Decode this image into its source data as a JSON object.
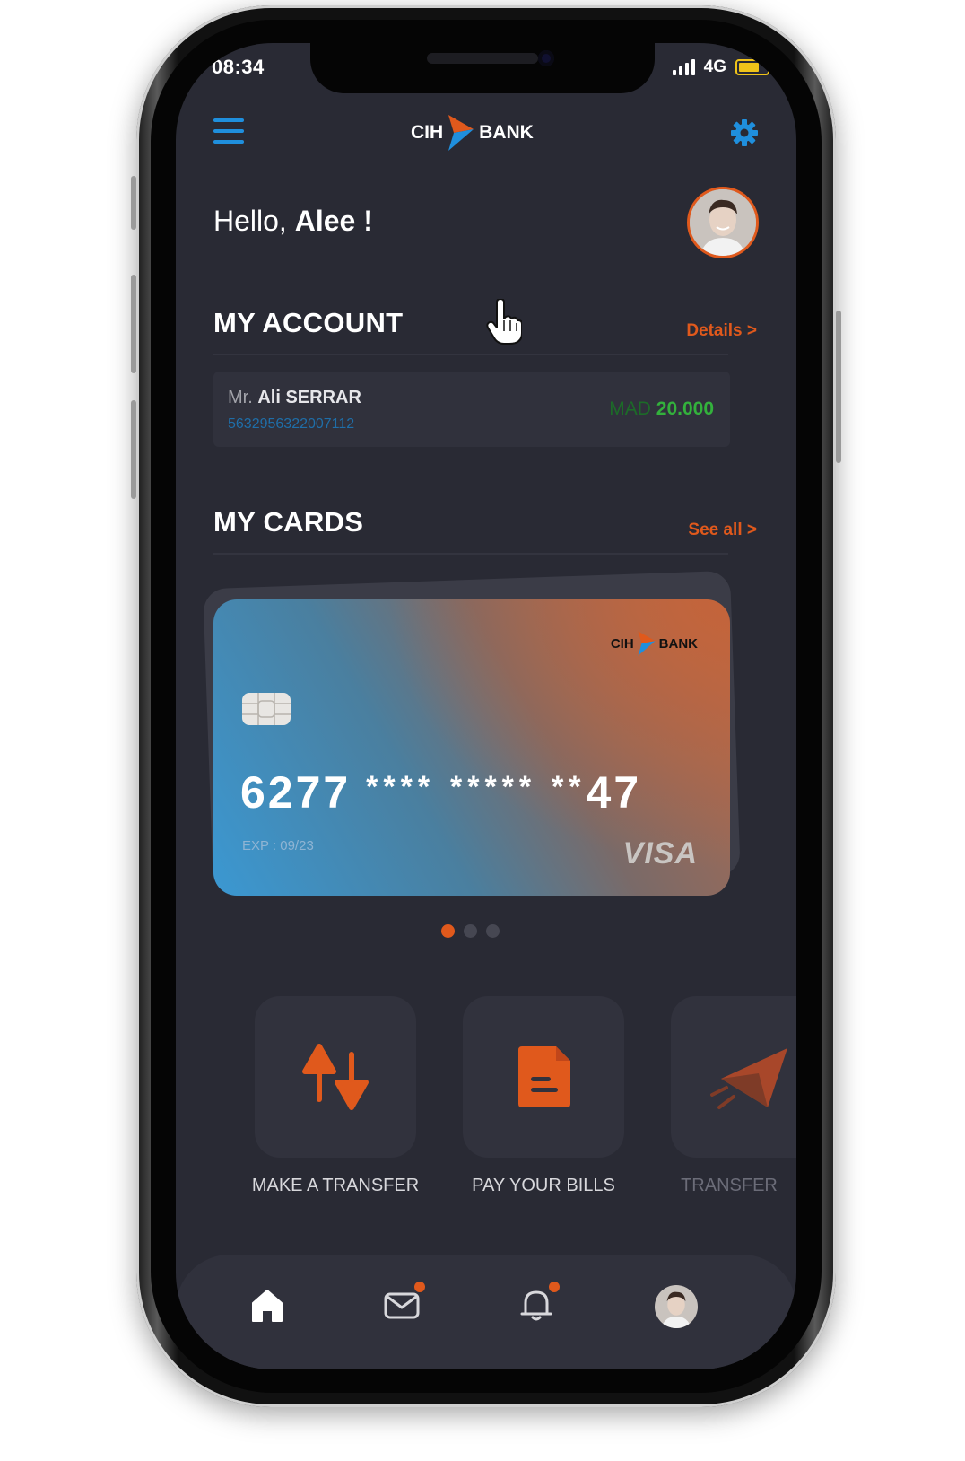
{
  "status_bar": {
    "time": "08:34",
    "network": "4G"
  },
  "header": {
    "logo_left": "CIH",
    "logo_right": "BANK"
  },
  "greeting": {
    "prefix": "Hello, ",
    "name": "Alee !"
  },
  "account_section": {
    "title": "MY ACCOUNT",
    "link": "Details >",
    "holder_prefix": "Mr.",
    "holder_name": "Ali SERRAR",
    "account_number": "5632956322007112",
    "currency": "MAD",
    "balance": "20.000"
  },
  "cards_section": {
    "title": "MY CARDS",
    "link": "See all >",
    "card": {
      "logo_left": "CIH",
      "logo_right": "BANK",
      "number_first": "6277",
      "number_masked_1": "****",
      "number_masked_2": "*****",
      "number_masked_3": "**",
      "number_last": "47",
      "expiry": "EXP : 09/23",
      "network": "VISA"
    },
    "pager": {
      "count": 3,
      "active_index": 0
    }
  },
  "actions": [
    {
      "label": "MAKE A TRANSFER",
      "icon": "transfer-arrows-icon"
    },
    {
      "label": "PAY YOUR BILLS",
      "icon": "bill-document-icon"
    },
    {
      "label": "TRANSFER",
      "icon": "paper-plane-icon"
    }
  ],
  "bottom_nav": [
    {
      "name": "home",
      "icon": "home-icon"
    },
    {
      "name": "messages",
      "icon": "mail-icon",
      "badge": true
    },
    {
      "name": "notifications",
      "icon": "bell-icon",
      "badge": true
    },
    {
      "name": "profile",
      "icon": "avatar"
    }
  ],
  "colors": {
    "background": "#292a34",
    "accent_orange": "#e0591c",
    "accent_blue": "#1f8fdd",
    "balance_green": "#33b13c"
  }
}
